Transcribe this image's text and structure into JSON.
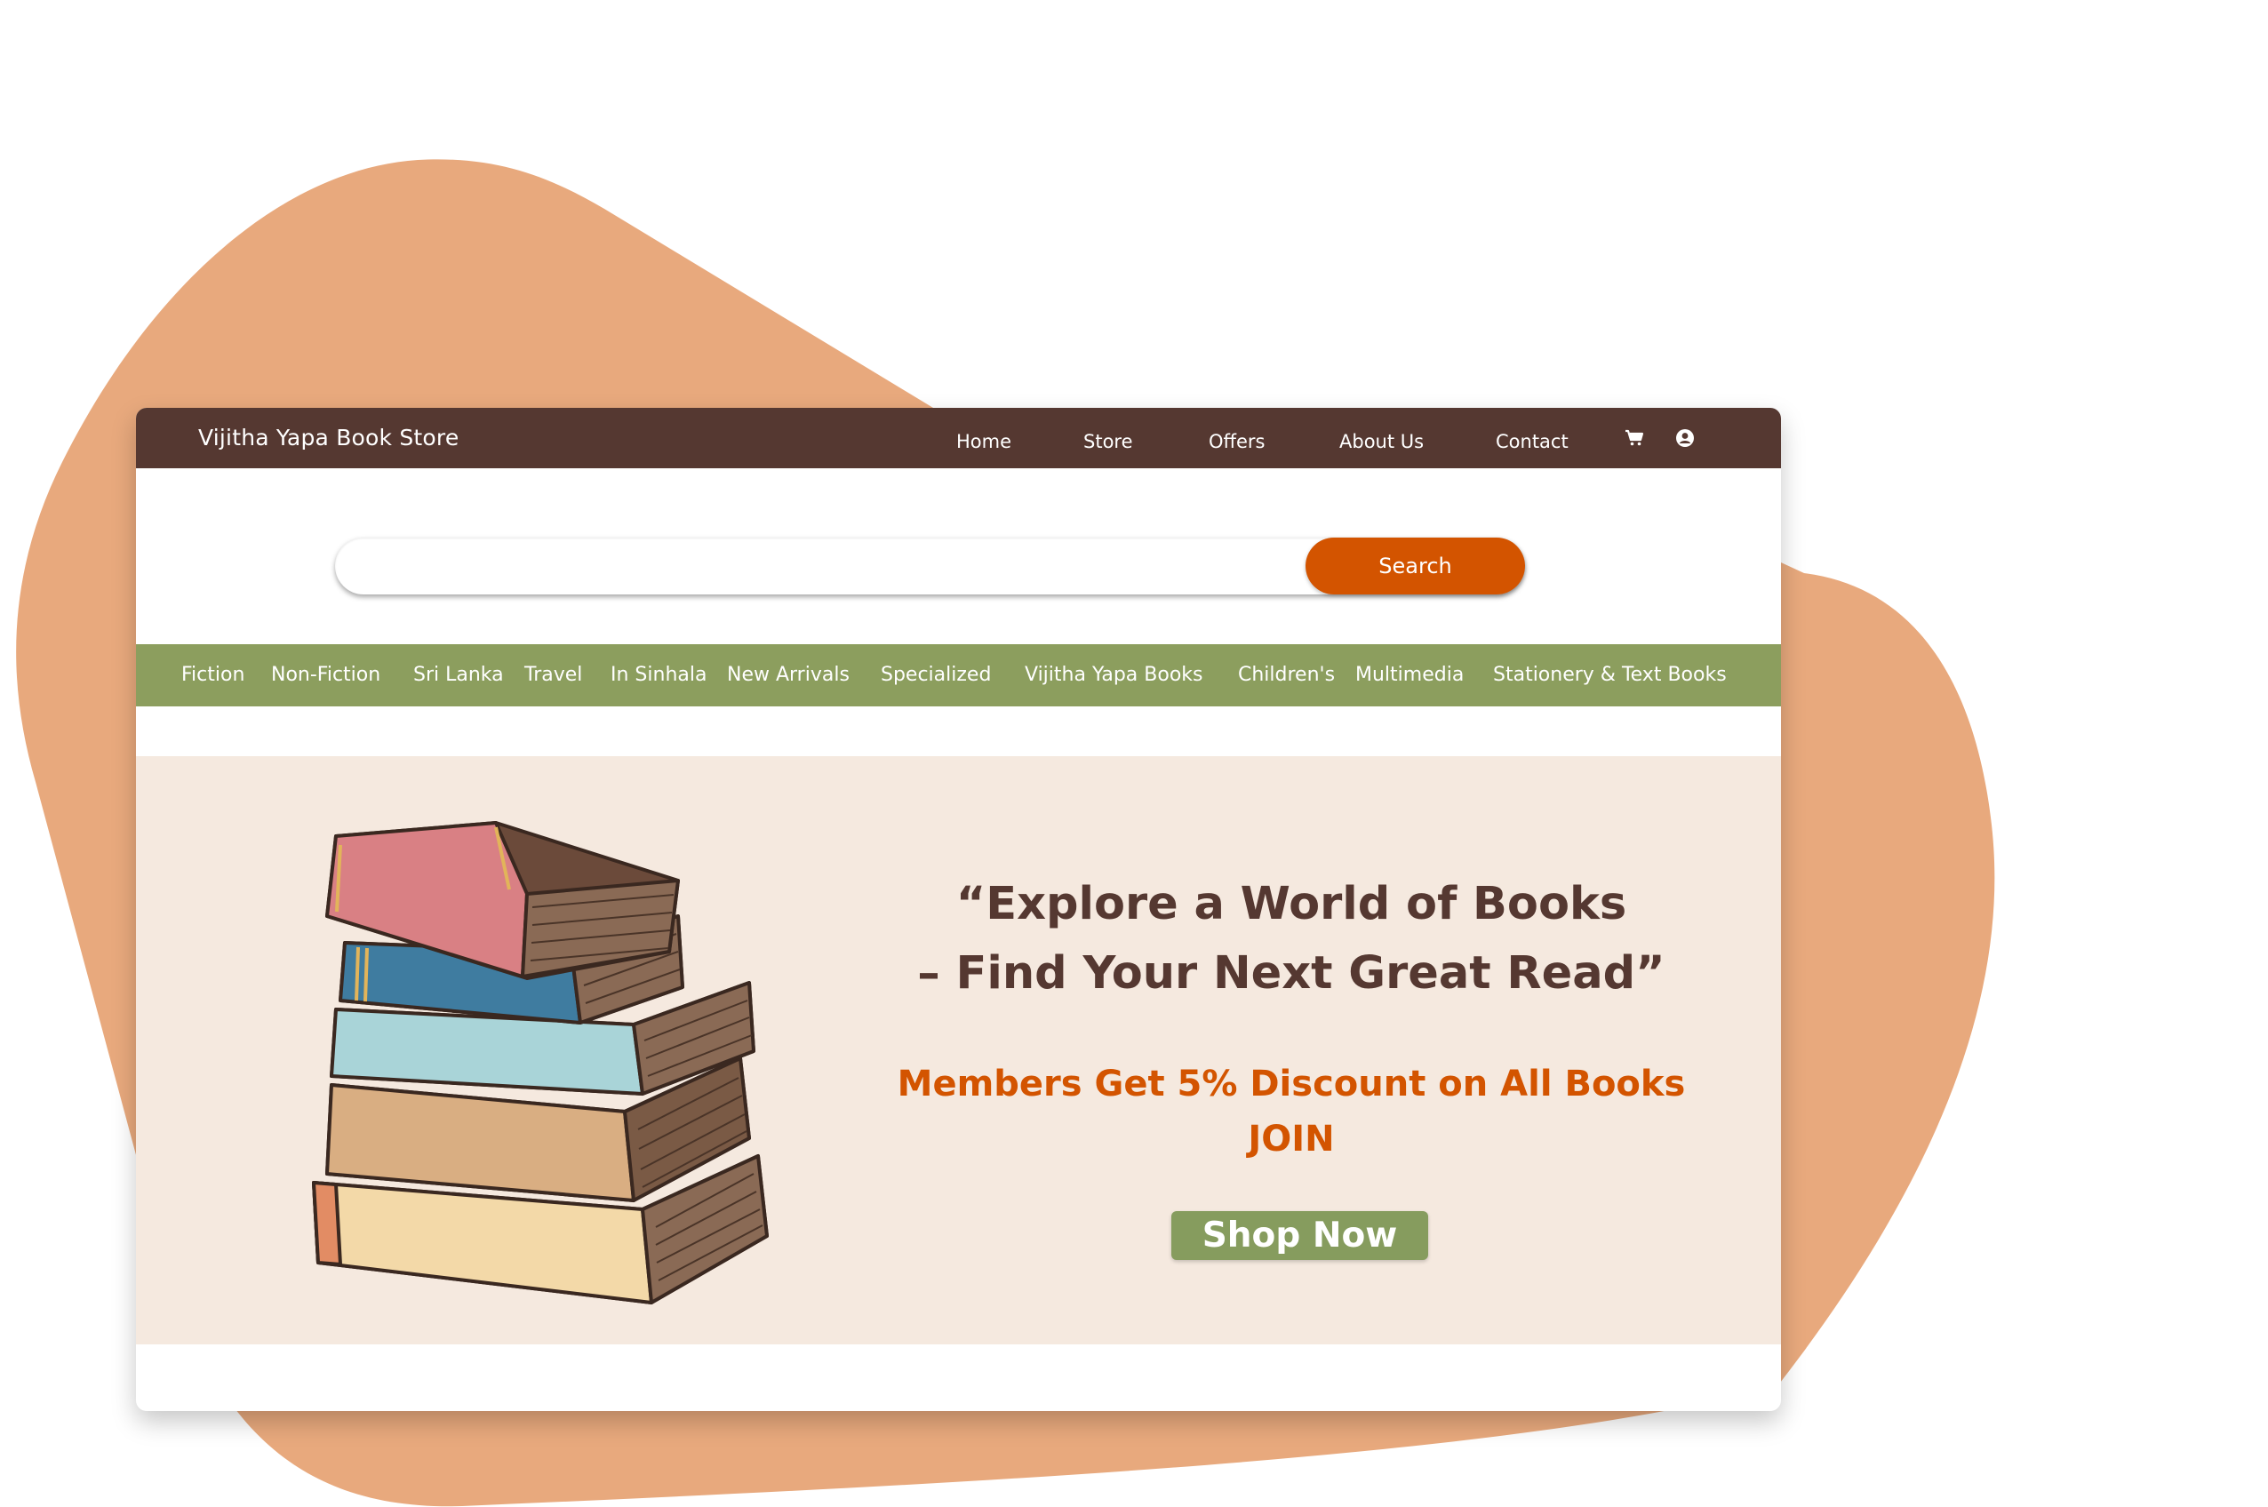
{
  "colors": {
    "blob": "#e8a97d",
    "topbar": "#553831",
    "search_button": "#d35400",
    "category_bar": "#8c9e5e",
    "hero_background": "#f5e9df",
    "headline": "#553831",
    "offer": "#d35400",
    "shop_button": "#869c5e"
  },
  "header": {
    "brand": "Vijitha Yapa Book Store",
    "nav": [
      "Home",
      "Store",
      "Offers",
      "About Us",
      "Contact"
    ],
    "icons": [
      "cart-icon",
      "user-account-icon"
    ]
  },
  "search": {
    "value": "",
    "placeholder": "",
    "button_label": "Search"
  },
  "categories": [
    "Fiction",
    "Non-Fiction",
    "Sri Lanka",
    "Travel",
    "In Sinhala",
    "New Arrivals",
    "Specialized",
    "Vijitha Yapa Books",
    "Children's",
    "Multimedia",
    "Stationery & Text Books"
  ],
  "hero": {
    "headline_line1": "“Explore a World of Books",
    "headline_line2": "– Find Your Next Great Read”",
    "offer_line1": "Members  Get 5% Discount on All Books",
    "offer_line2": "JOIN",
    "cta": "Shop Now"
  }
}
